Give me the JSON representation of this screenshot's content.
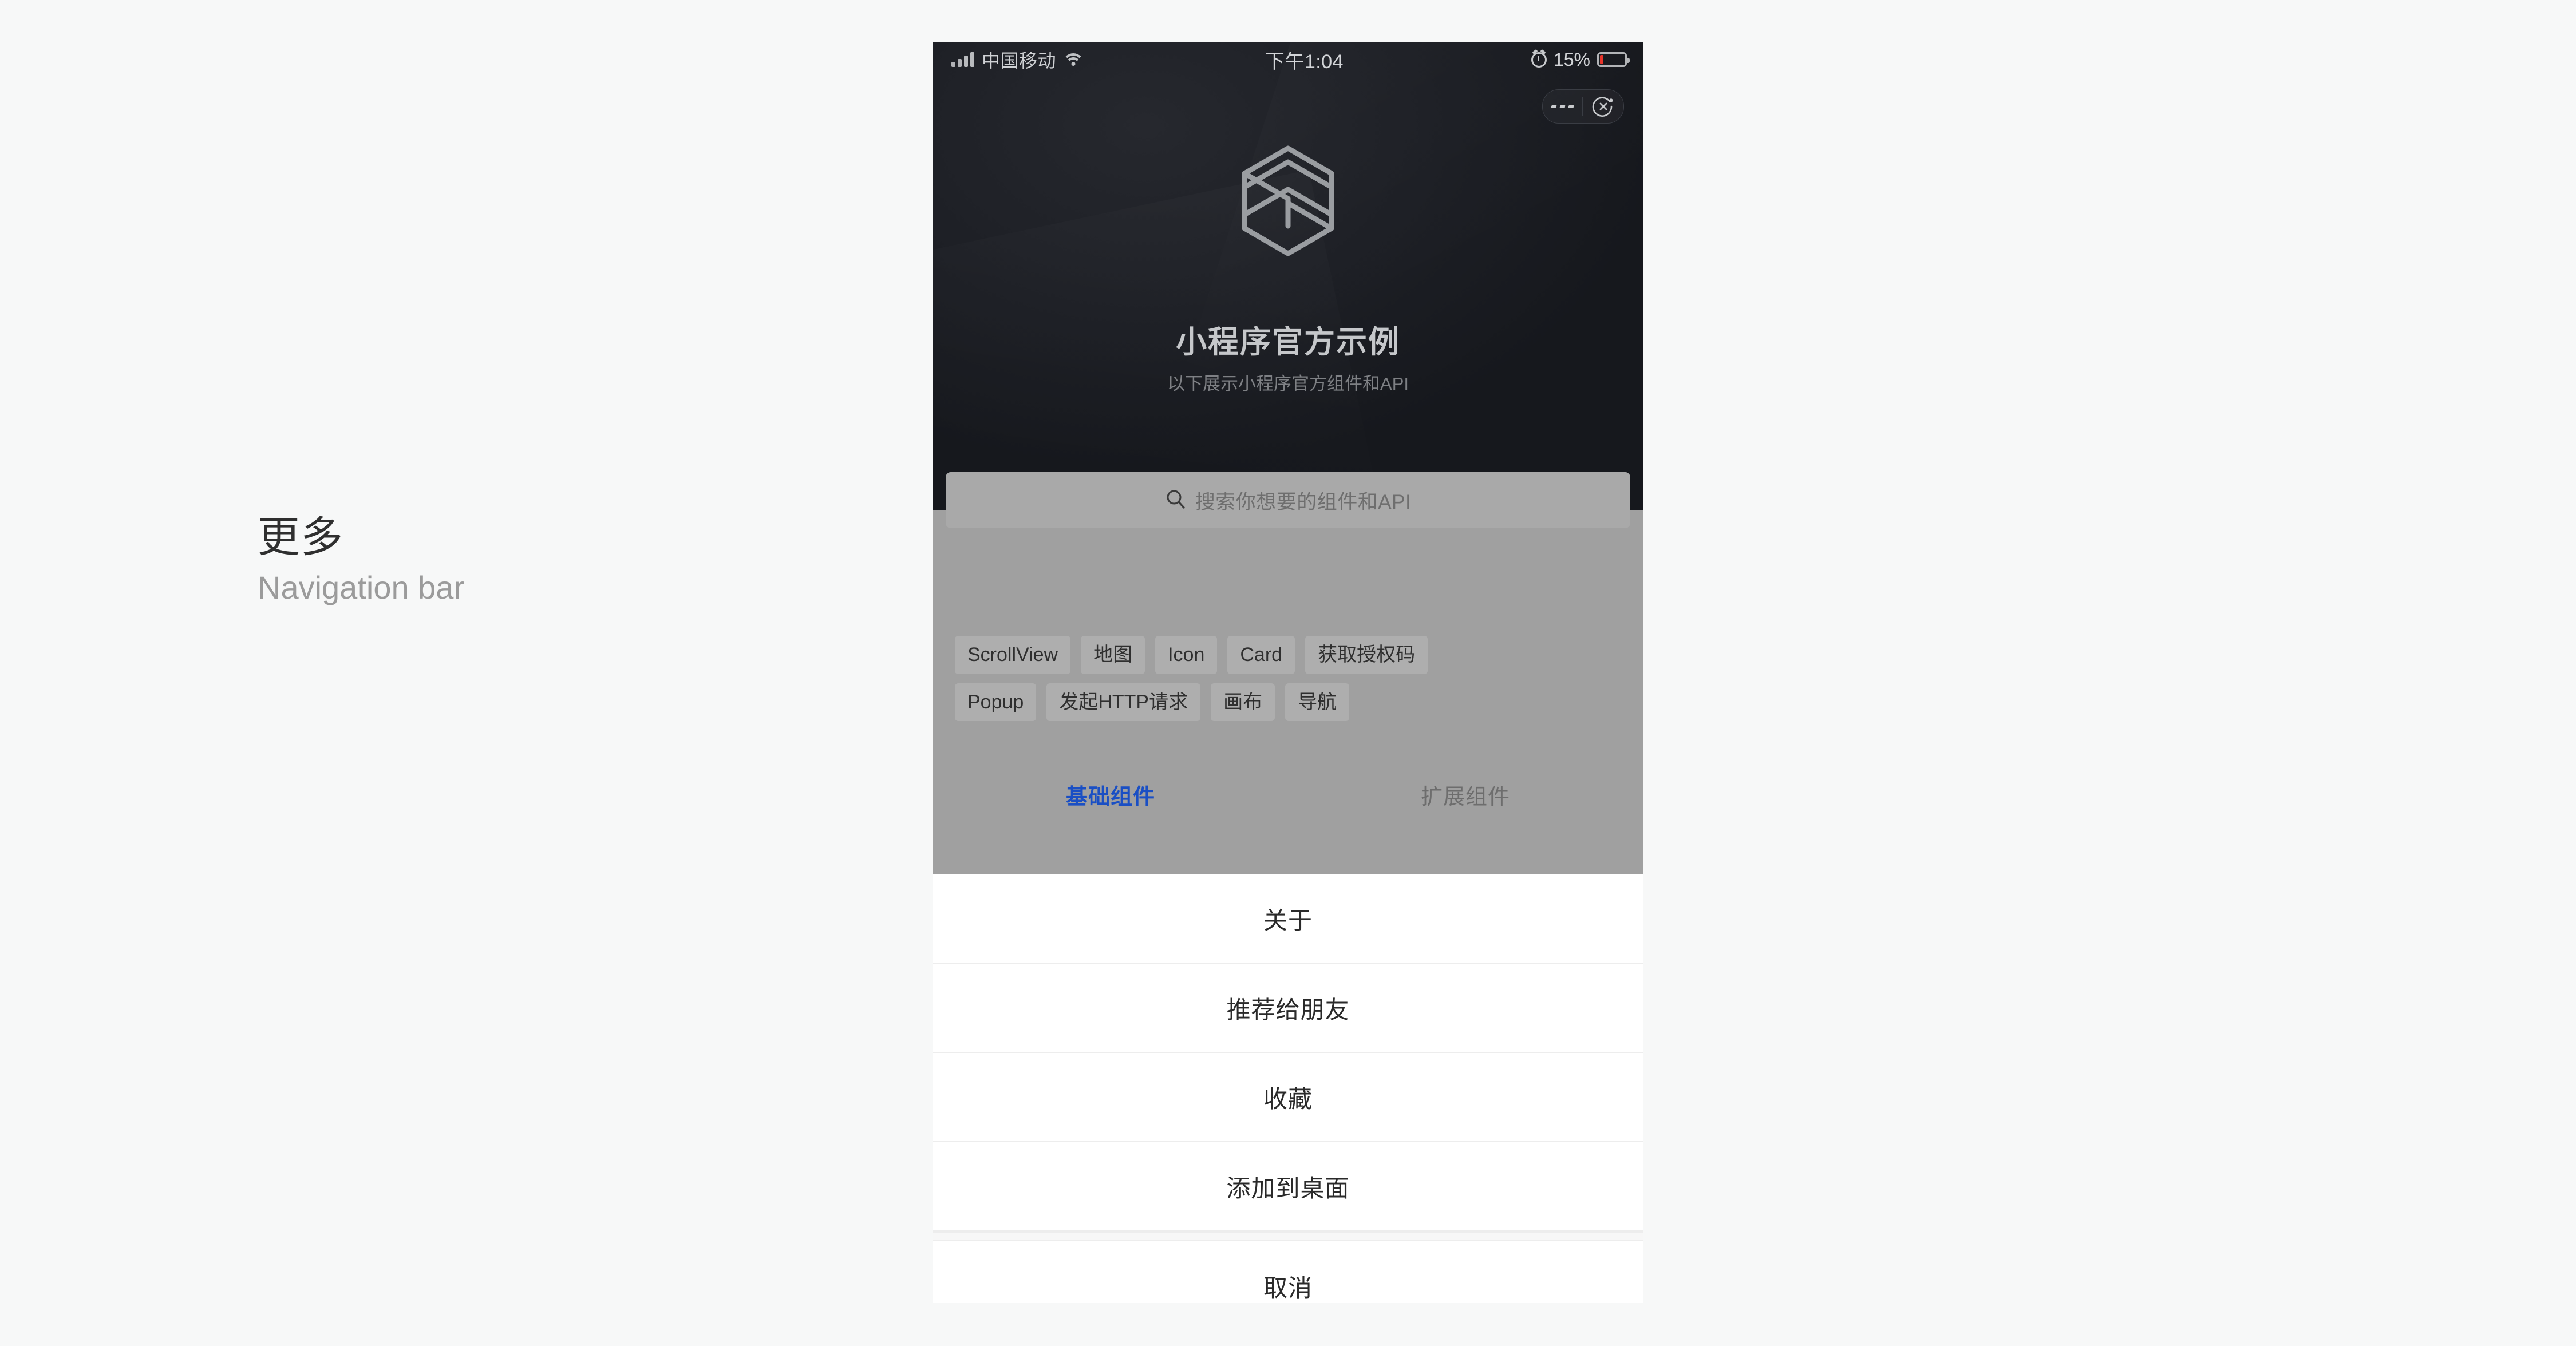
{
  "annotation": {
    "title": "更多",
    "subtitle": "Navigation bar"
  },
  "phone": {
    "status_bar": {
      "carrier": "中国移动",
      "time": "下午1:04",
      "battery_percent": "15%",
      "battery_level": 15,
      "signal_icon": "signal-bars-icon",
      "wifi_icon": "wifi-icon",
      "alarm_icon": "alarm-clock-icon",
      "battery_icon": "battery-icon"
    },
    "capsule": {
      "more_icon": "more-dots-icon",
      "close_icon": "close-circle-icon"
    },
    "hero": {
      "logo_icon": "hexagon-logo-icon",
      "title": "小程序官方示例",
      "subtitle": "以下展示小程序官方组件和API"
    },
    "search": {
      "icon": "search-icon",
      "placeholder": "搜索你想要的组件和API",
      "value": ""
    },
    "chips": {
      "row1": [
        "ScrollView",
        "地图",
        "Icon",
        "Card",
        "获取授权码"
      ],
      "row2": [
        "Popup",
        "发起HTTP请求",
        "画布",
        "导航"
      ]
    },
    "tabs": [
      {
        "label": "基础组件",
        "active": true
      },
      {
        "label": "扩展组件",
        "active": false
      }
    ],
    "action_sheet": {
      "items": [
        "关于",
        "推荐给朋友",
        "收藏",
        "添加到桌面"
      ],
      "cancel": "取消"
    }
  },
  "colors": {
    "page_bg": "#f7f8f8",
    "hero_dark": "#1d1f25",
    "dim_overlay": "#a0a0a0",
    "sheet_white": "#ffffff",
    "tab_active": "#1a4fc4",
    "battery_low": "#e8342a"
  }
}
